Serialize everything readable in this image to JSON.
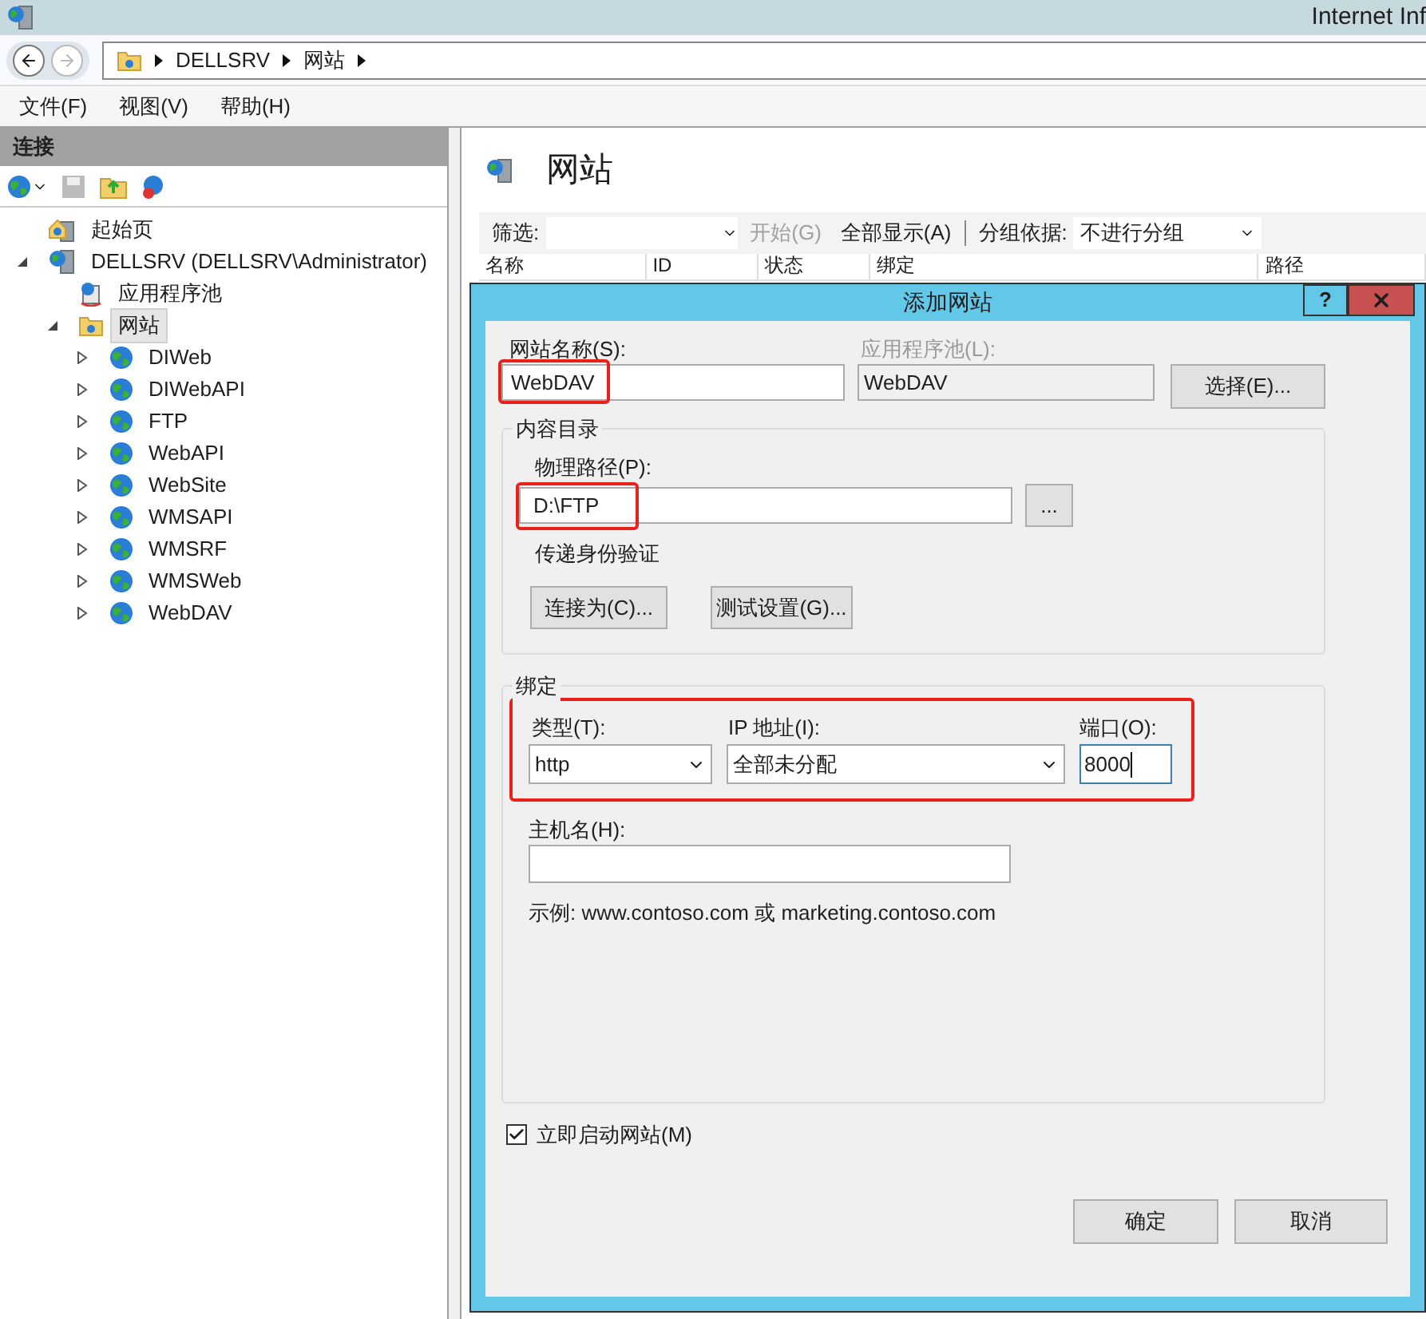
{
  "window": {
    "title": "Internet Inf"
  },
  "address_bar": {
    "crumbs": [
      "DELLSRV",
      "网站"
    ]
  },
  "menu": [
    "文件(F)",
    "视图(V)",
    "帮助(H)"
  ],
  "connections": {
    "title": "连接",
    "tree": [
      {
        "label": "起始页",
        "kind": "start",
        "selected": false
      },
      {
        "label": "DELLSRV (DELLSRV\\Administrator)",
        "kind": "server",
        "expanded": true,
        "selected": false,
        "children": [
          {
            "label": "应用程序池",
            "kind": "pool",
            "selected": false
          },
          {
            "label": "网站",
            "kind": "sites",
            "expanded": true,
            "selected": true,
            "children": [
              {
                "label": "DIWeb",
                "kind": "site",
                "expanded": false,
                "selected": false
              },
              {
                "label": "DIWebAPI",
                "kind": "site",
                "expanded": false,
                "selected": false
              },
              {
                "label": "FTP",
                "kind": "site",
                "expanded": false,
                "selected": false
              },
              {
                "label": "WebAPI",
                "kind": "site",
                "expanded": false,
                "selected": false
              },
              {
                "label": "WebSite",
                "kind": "site",
                "expanded": false,
                "selected": false
              },
              {
                "label": "WMSAPI",
                "kind": "site",
                "expanded": false,
                "selected": false
              },
              {
                "label": "WMSRF",
                "kind": "site",
                "expanded": false,
                "selected": false
              },
              {
                "label": "WMSWeb",
                "kind": "site",
                "expanded": false,
                "selected": false
              },
              {
                "label": "WebDAV",
                "kind": "site",
                "expanded": false,
                "selected": false
              }
            ]
          }
        ]
      }
    ]
  },
  "main": {
    "title": "网站",
    "filter": {
      "label": "筛选:",
      "start": {
        "label": "开始(G)",
        "disabled": true
      },
      "show_all": "全部显示(A)",
      "group_label": "分组依据:",
      "group_value": "不进行分组"
    },
    "columns": [
      "名称",
      "ID",
      "状态",
      "绑定",
      "路径"
    ]
  },
  "dialog": {
    "title": "添加网站",
    "help": "?",
    "site_name": {
      "label": "网站名称(S):",
      "value": "WebDAV",
      "highlighted": true
    },
    "app_pool": {
      "label": "应用程序池(L):",
      "value": "WebDAV",
      "disabled": true
    },
    "select_button": "选择(E)...",
    "content_dir": {
      "title": "内容目录",
      "path_label": "物理路径(P):",
      "path_value": "D:\\FTP",
      "highlighted": true,
      "browse": "...",
      "pass_through": "传递身份验证",
      "connect_as": "连接为(C)...",
      "test_settings": "测试设置(G)..."
    },
    "binding": {
      "title": "绑定",
      "highlighted": true,
      "type_label": "类型(T):",
      "type_value": "http",
      "ip_label": "IP 地址(I):",
      "ip_value": "全部未分配",
      "port_label": "端口(O):",
      "port_value": "8000",
      "host_label": "主机名(H):",
      "example": "示例: www.contoso.com 或 marketing.contoso.com"
    },
    "start_now": {
      "label": "立即启动网站(M)",
      "checked": true
    },
    "ok": "确定",
    "cancel": "取消"
  }
}
